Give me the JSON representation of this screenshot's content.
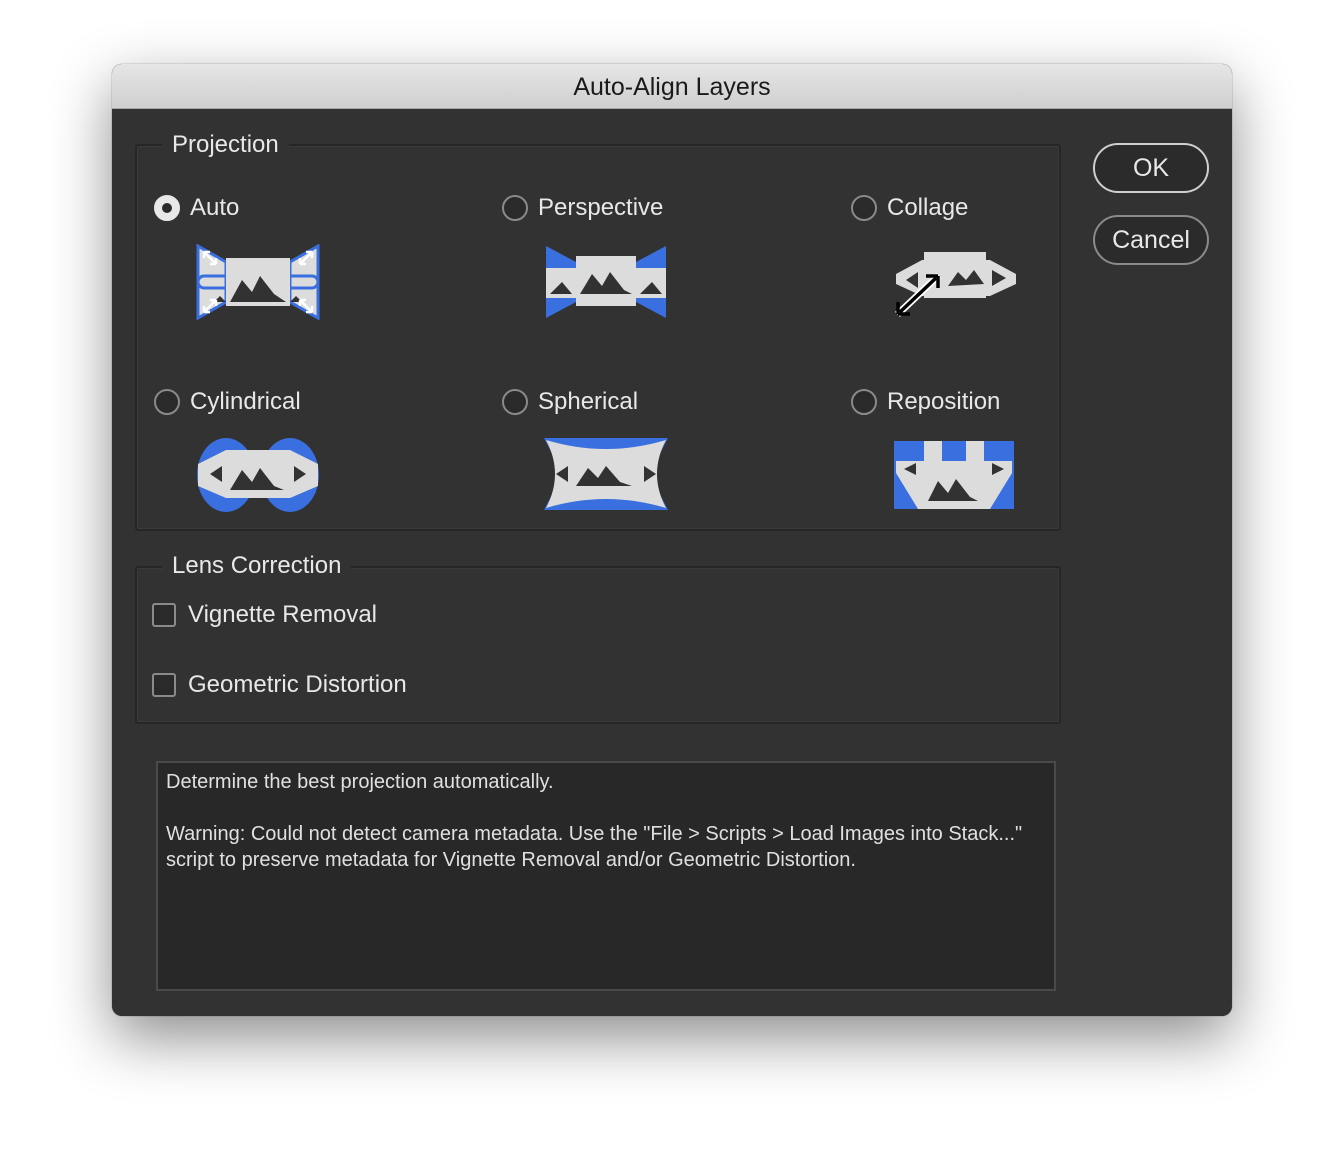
{
  "window": {
    "title": "Auto-Align Layers"
  },
  "projection": {
    "title": "Projection",
    "options": [
      {
        "label": "Auto",
        "selected": true,
        "icon": "auto-projection-icon"
      },
      {
        "label": "Perspective",
        "selected": false,
        "icon": "perspective-projection-icon"
      },
      {
        "label": "Collage",
        "selected": false,
        "icon": "collage-projection-icon"
      },
      {
        "label": "Cylindrical",
        "selected": false,
        "icon": "cylindrical-projection-icon"
      },
      {
        "label": "Spherical",
        "selected": false,
        "icon": "spherical-projection-icon"
      },
      {
        "label": "Reposition",
        "selected": false,
        "icon": "reposition-projection-icon"
      }
    ]
  },
  "lens_correction": {
    "title": "Lens Correction",
    "vignette_removal": {
      "label": "Vignette Removal",
      "checked": false
    },
    "geometric_distortion": {
      "label": "Geometric Distortion",
      "checked": false
    }
  },
  "description": {
    "line1": "Determine the best projection automatically.",
    "line2": "Warning: Could not detect camera metadata. Use the \"File > Scripts > Load Images into Stack...\" script to preserve metadata for Vignette Removal and/or Geometric Distortion."
  },
  "buttons": {
    "ok": "OK",
    "cancel": "Cancel"
  },
  "colors": {
    "accent": "#3a6fe0",
    "icon_fill": "#dcdcdc",
    "background": "#323232"
  }
}
